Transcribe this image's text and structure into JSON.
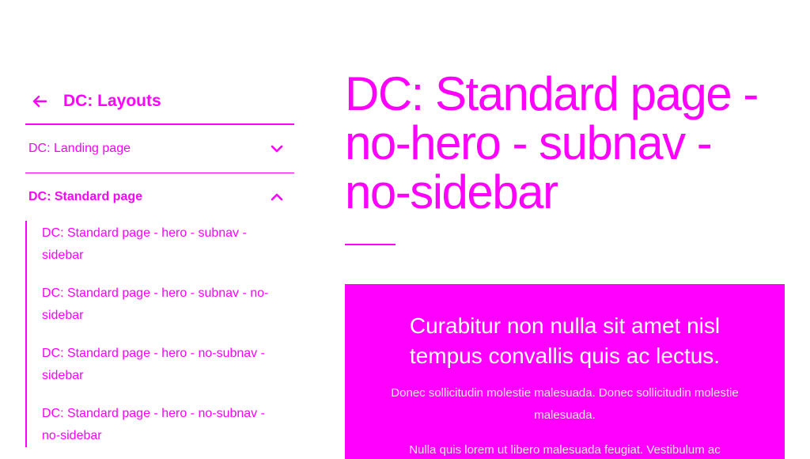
{
  "sidebar": {
    "back_label": "DC: Layouts",
    "sections": [
      {
        "label": "DC: Landing page",
        "expanded": false
      },
      {
        "label": "DC: Standard page",
        "expanded": true
      }
    ],
    "subnav": [
      "DC: Standard page - hero - subnav - sidebar",
      "DC: Standard page - hero - subnav - no-sidebar",
      "DC: Standard page - hero - no-subnav - sidebar",
      "DC: Standard page - hero - no-subnav - no-sidebar"
    ]
  },
  "main": {
    "title": "DC: Standard page - no-hero - subnav - no-sidebar",
    "hero": {
      "heading": "Curabitur non nulla sit amet nisl tempus convallis quis ac lectus.",
      "paragraphs": [
        "Donec sollicitudin molestie malesuada. Donec sollicitudin molestie malesuada.",
        "Nulla quis lorem ut libero malesuada feugiat. Vestibulum ac"
      ]
    }
  },
  "colors": {
    "accent": "#ff00ff",
    "background": "#ffffff"
  },
  "icons": {
    "back": "arrow-left-icon",
    "collapsed": "chevron-down-icon",
    "expanded": "chevron-up-icon"
  }
}
